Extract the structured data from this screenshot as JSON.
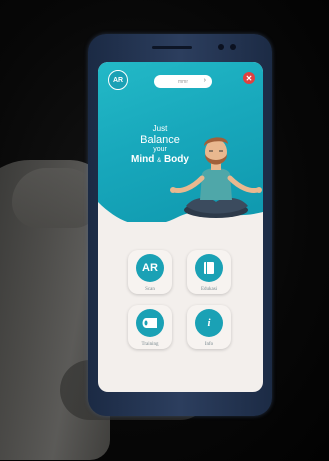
{
  "app": {
    "avatar_text": "AR",
    "selector_text": "mmr",
    "close_glyph": "✕",
    "tagline": {
      "line1": "Just",
      "line2": "Balance",
      "line3": "your",
      "line4a": "Mind",
      "amp": "&",
      "line4b": "Body"
    },
    "menu": [
      {
        "label": "Scan",
        "icon": "ar-scan-icon",
        "glyph": "AR"
      },
      {
        "label": "Edukasi",
        "icon": "book-icon",
        "glyph": ""
      },
      {
        "label": "Training",
        "icon": "mat-icon",
        "glyph": ""
      },
      {
        "label": "Info",
        "icon": "info-icon",
        "glyph": "i"
      }
    ]
  },
  "colors": {
    "teal": "#1aa1b5",
    "header_gradient_start": "#23b9c7",
    "header_gradient_end": "#0f98ae",
    "screen_bg": "#f3efec",
    "close_red": "#e04040"
  }
}
